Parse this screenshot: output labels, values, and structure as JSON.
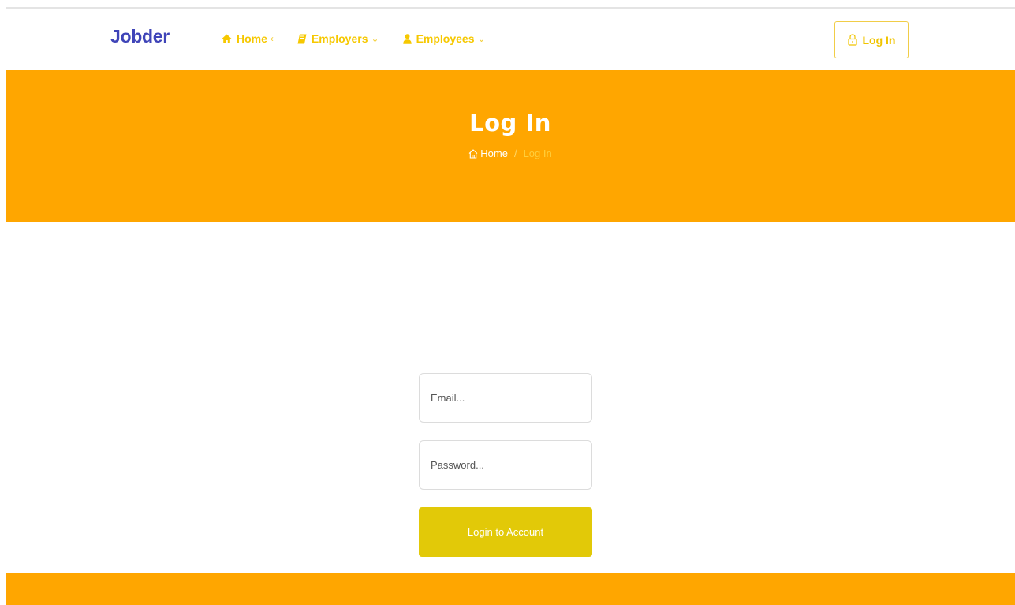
{
  "brand": "Jobder",
  "nav": {
    "items": [
      {
        "label": "Home",
        "chevron": "‹",
        "icon": "home-icon"
      },
      {
        "label": "Employers",
        "chevron": "⌄",
        "icon": "book-icon"
      },
      {
        "label": "Employees",
        "chevron": "⌄",
        "icon": "user-icon"
      }
    ],
    "login_label": "Log In"
  },
  "hero": {
    "title": "Log In",
    "breadcrumb": {
      "home": "Home",
      "separator": "/",
      "current": "Log In"
    }
  },
  "form": {
    "email_placeholder": "Email...",
    "password_placeholder": "Password...",
    "submit_label": "Login to Account"
  },
  "colors": {
    "brand": "#3f44b8",
    "accent": "#ffa600",
    "nav_text": "#f6c800",
    "button": "#e2c908"
  }
}
